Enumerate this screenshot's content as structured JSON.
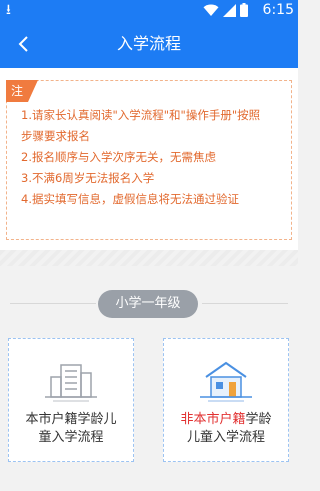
{
  "statusbar": {
    "time": "6:15",
    "download_glyph": "⭳"
  },
  "header": {
    "title": "入学流程"
  },
  "notice": {
    "tag": "注",
    "rules": [
      {
        "l1": "1.请家长认真阅读\"入学流程\"和\"操作手册\"按照",
        "l2": "步骤要求报名"
      },
      {
        "l1": "2.报名顺序与入学次序无关，无需焦虑"
      },
      {
        "l1": "3.不满6周岁无法报名入学"
      },
      {
        "l1": "4.据实填写信息，虚假信息将无法通过验证"
      }
    ]
  },
  "grade": {
    "label": "小学一年级"
  },
  "cards": {
    "local": {
      "line1": "本市户籍学龄儿",
      "line2": "童入学流程"
    },
    "nonlocal": {
      "hl": "非本市户籍",
      "rest1": "学龄",
      "line2": "儿童入学流程"
    }
  },
  "colors": {
    "primary": "#1d7cf4",
    "accent": "#f07b3f",
    "highlight": "#e23131"
  },
  "icons": [
    "download-icon",
    "wifi-icon",
    "signal-icon",
    "battery-icon",
    "back-arrow-icon",
    "building-icon",
    "house-icon"
  ]
}
